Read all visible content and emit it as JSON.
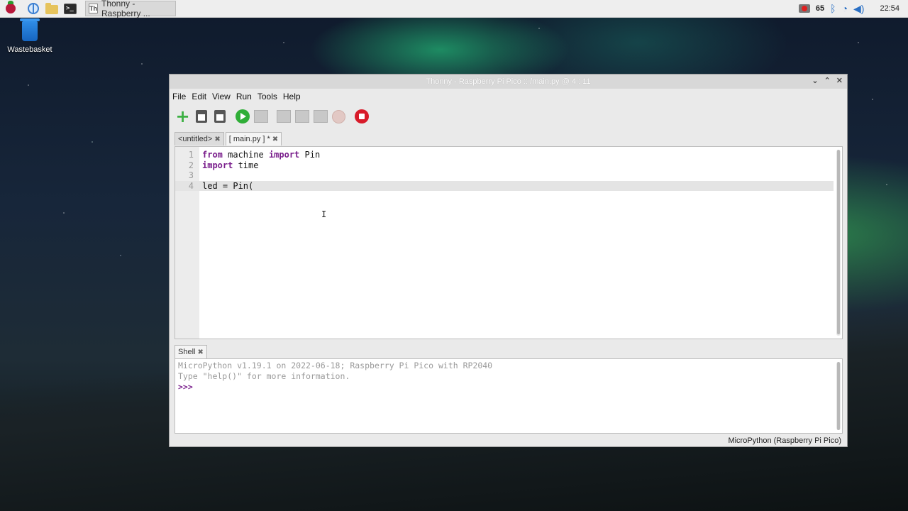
{
  "taskbar": {
    "window_button_label": "Thonny  -  Raspberry ...",
    "tray": {
      "battery_or_cpu": "65",
      "clock": "22:54"
    }
  },
  "desktop": {
    "icon_label": "Wastebasket"
  },
  "window": {
    "title": "Thonny  -  Raspberry Pi Pico :: /main.py  @  4 : 11",
    "menu": [
      "File",
      "Edit",
      "View",
      "Run",
      "Tools",
      "Help"
    ],
    "tabs": [
      {
        "label": "<untitled>"
      },
      {
        "label": "[ main.py ] *"
      }
    ],
    "editor": {
      "lines": [
        {
          "num": "1",
          "kw1": "from",
          "mid": " machine ",
          "kw2": "import",
          "tail": " Pin"
        },
        {
          "num": "2",
          "kw1": "import",
          "mid": " time",
          "kw2": "",
          "tail": ""
        },
        {
          "num": "3",
          "kw1": "",
          "mid": "",
          "kw2": "",
          "tail": ""
        },
        {
          "num": "4",
          "kw1": "",
          "mid": "led = Pin(",
          "kw2": "",
          "tail": ""
        }
      ]
    },
    "shell": {
      "tab_label": "Shell",
      "line1": "MicroPython v1.19.1 on 2022-06-18; Raspberry Pi Pico with RP2040",
      "line2": "Type \"help()\" for more information.",
      "prompt": ">>>"
    },
    "status": "MicroPython (Raspberry Pi Pico)"
  },
  "icons": {
    "toolbar": [
      "new-icon",
      "open-icon",
      "save-icon",
      "run-icon",
      "debug-icon",
      "step-over-icon",
      "step-into-icon",
      "step-out-icon",
      "resume-icon",
      "stop-icon"
    ]
  }
}
